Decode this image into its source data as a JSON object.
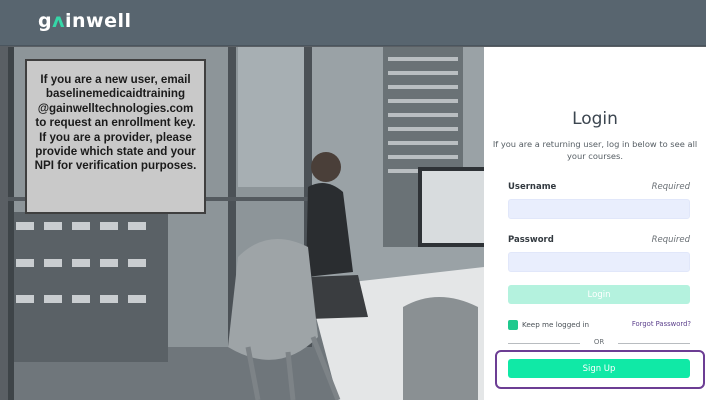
{
  "header": {
    "logo_prefix": "g",
    "logo_accent": "ᴧ",
    "logo_suffix": "inwell",
    "background_color": "#58656f"
  },
  "notice": {
    "line1": "If you are a new user, email",
    "line2": "baselinemedicaidtraining",
    "line3": "@gainwelltechnologies.com",
    "line4": "to request an enrollment key.",
    "line5": "If you are a provider, please",
    "line6": "provide which state and your",
    "line7": "NPI for verification purposes."
  },
  "login": {
    "title": "Login",
    "subtitle": "If you are a returning user, log in below to see all your courses.",
    "username_label": "Username",
    "username_required": "Required",
    "username_value": "",
    "password_label": "Password",
    "password_required": "Required",
    "password_value": "",
    "login_button": "Login",
    "keep_logged_in": "Keep me logged in",
    "keep_logged_in_checked": true,
    "forgot_password": "Forgot Password?",
    "or_divider": "OR",
    "signup_button": "Sign Up"
  },
  "colors": {
    "accent_green": "#10e9a6",
    "login_button_disabled": "#b4f2de",
    "highlight_purple": "#6c3d94",
    "input_background": "#e9eefd"
  }
}
